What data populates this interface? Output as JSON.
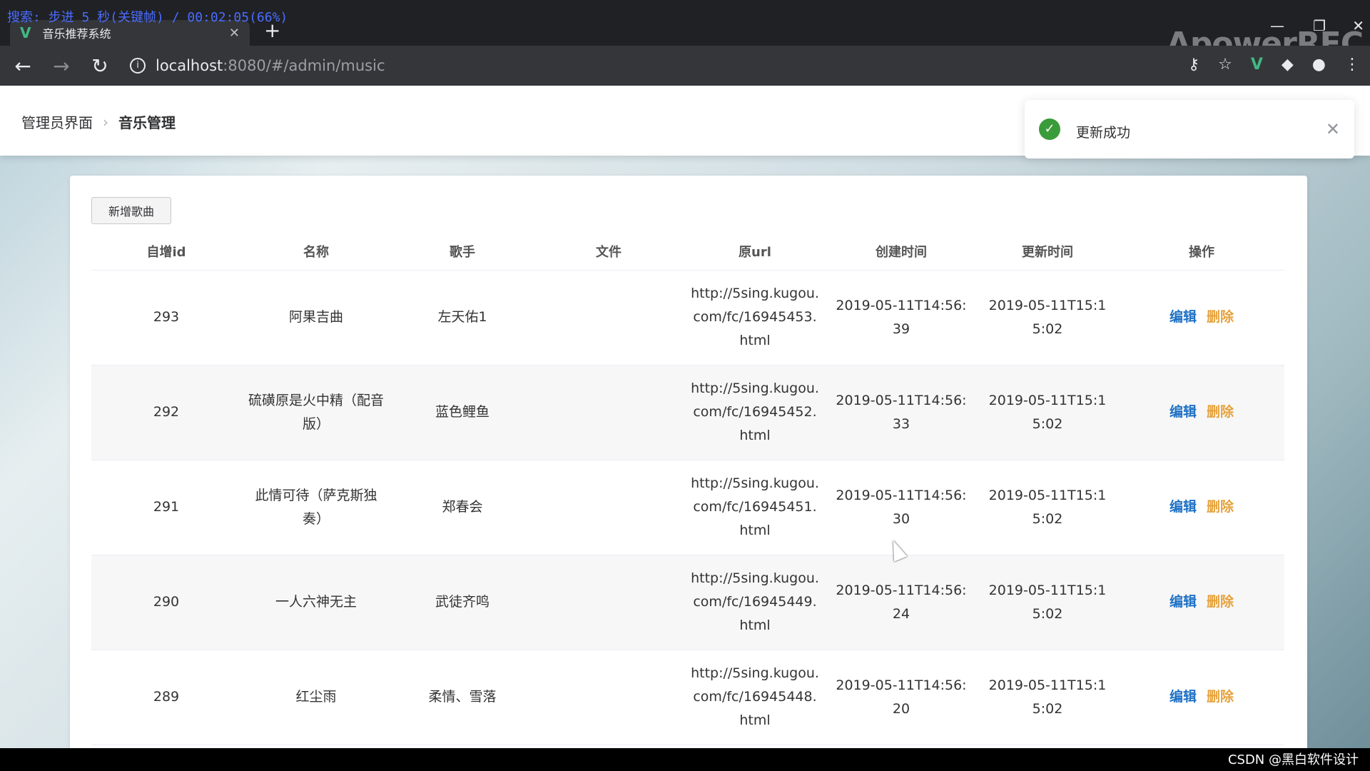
{
  "overlay": {
    "text": "搜索: 步进 5 秒(关键帧) / 00:02:05(66%)"
  },
  "browser": {
    "tab_title": "音乐推荐系统",
    "url_host": "localhost",
    "url_path": ":8080/#/admin/music",
    "watermark": "ApowerREC"
  },
  "breadcrumb": {
    "root": "管理员界面",
    "current": "音乐管理"
  },
  "toast": {
    "message": "更新成功"
  },
  "toolbar": {
    "add_label": "新增歌曲"
  },
  "table": {
    "headers": [
      "自增id",
      "名称",
      "歌手",
      "文件",
      "原url",
      "创建时间",
      "更新时间",
      "操作"
    ],
    "rows": [
      {
        "id": "293",
        "name": "阿果吉曲",
        "singer": "左天佑1",
        "file": "",
        "url": "http://5sing.kugou.com/fc/16945453.html",
        "created": "2019-05-11T14:56:39",
        "updated": "2019-05-11T15:15:02"
      },
      {
        "id": "292",
        "name": "硫磺原是火中精（配音版）",
        "singer": "蓝色鲤鱼",
        "file": "",
        "url": "http://5sing.kugou.com/fc/16945452.html",
        "created": "2019-05-11T14:56:33",
        "updated": "2019-05-11T15:15:02"
      },
      {
        "id": "291",
        "name": "此情可待（萨克斯独奏）",
        "singer": "郑春会",
        "file": "",
        "url": "http://5sing.kugou.com/fc/16945451.html",
        "created": "2019-05-11T14:56:30",
        "updated": "2019-05-11T15:15:02"
      },
      {
        "id": "290",
        "name": "一人六神无主",
        "singer": "武徒齐鸣",
        "file": "",
        "url": "http://5sing.kugou.com/fc/16945449.html",
        "created": "2019-05-11T14:56:24",
        "updated": "2019-05-11T15:15:02"
      },
      {
        "id": "289",
        "name": "红尘雨",
        "singer": "柔情、雪落",
        "file": "",
        "url": "http://5sing.kugou.com/fc/16945448.html",
        "created": "2019-05-11T14:56:20",
        "updated": "2019-05-11T15:15:02"
      }
    ],
    "actions": {
      "edit": "编辑",
      "delete": "删除"
    }
  },
  "footer": {
    "credit": "CSDN @黑白软件设计"
  }
}
